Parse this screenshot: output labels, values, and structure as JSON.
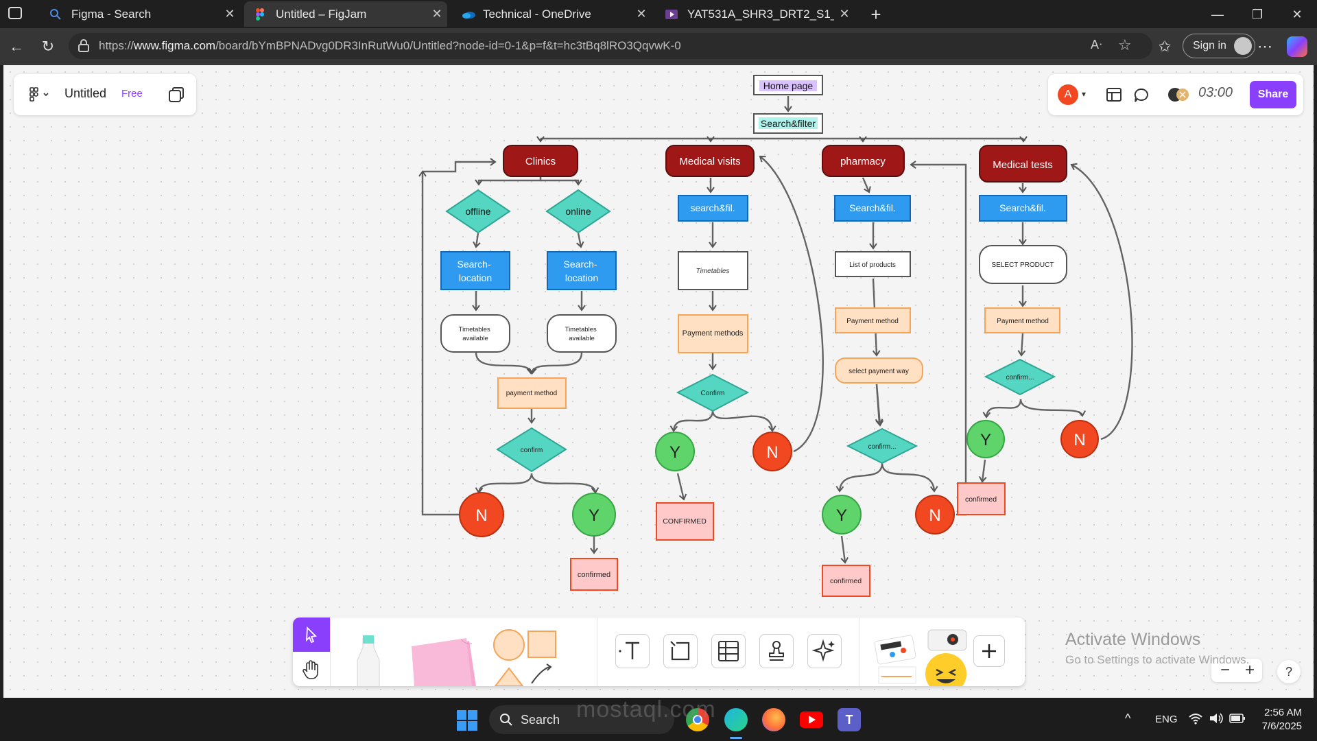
{
  "browser": {
    "tabs": [
      {
        "label": "Figma - Search",
        "icon": "search-icon"
      },
      {
        "label": "Untitled – FigJam",
        "icon": "figma-icon",
        "active": true
      },
      {
        "label": "Technical - OneDrive",
        "icon": "onedrive-icon"
      },
      {
        "label": "YAT531A_SHR3_DRT2_S1_DEPI3_D",
        "icon": "stream-icon"
      }
    ],
    "url_prefix": "https://",
    "url_domain": "www.figma.com",
    "url_path": "/board/bYmBPNADvg0DR3InRutWu0/Untitled?node-id=0-1&p=f&t=hc3tBq8lRO3QqvwK-0",
    "signin_label": "Sign in"
  },
  "figjam": {
    "file_title": "Untitled",
    "plan_badge": "Free",
    "avatar_letter": "A",
    "timer": "03:00",
    "share_label": "Share"
  },
  "flowchart": {
    "home": "Home page",
    "search_filter": "Search&filter",
    "clinics": {
      "title": "Clinics",
      "offline": "offline",
      "online": "online",
      "search_location": "Search-\nlocation",
      "timetables": "Timetables\navailable",
      "payment": "payment method",
      "confirm": "confirm",
      "no": "N",
      "yes": "Y",
      "confirmed": "confirmed"
    },
    "visits": {
      "title": "Medical visits",
      "search": "search&fil.",
      "timetables": "Timetables",
      "payment": "Payment methods",
      "confirm": "Confirm",
      "yes": "Y",
      "no": "N",
      "confirmed": "CONFIRMED"
    },
    "pharmacy": {
      "title": "pharmacy",
      "search": "Search&fil.",
      "products": "List of products",
      "payment": "Payment method",
      "select_way": "select payment way",
      "confirm": "confirm...",
      "yes": "Y",
      "no": "N",
      "confirmed": "confirmed"
    },
    "tests": {
      "title": "Medical tests",
      "search": "Search&fil.",
      "select_product": "SELECT PRODUCT",
      "payment": "Payment method",
      "confirm": "confirm...",
      "yes": "Y",
      "no": "N",
      "confirmed": "confirmed"
    }
  },
  "windows": {
    "activate_title": "Activate Windows",
    "activate_sub": "Go to Settings to activate Windows.",
    "watermark": "mostaql.com",
    "taskbar_search": "Search",
    "language": "ENG",
    "time": "2:56 AM",
    "date": "7/6/2025"
  },
  "colors": {
    "accent": "#8a3ffc",
    "dark_red": "#a01717",
    "blue": "#2e9bf0",
    "teal": "#55d6c2",
    "orange_fill": "#ffe0c2",
    "green": "#5fd46a",
    "red": "#f24822",
    "pink": "#ffc9c9"
  }
}
